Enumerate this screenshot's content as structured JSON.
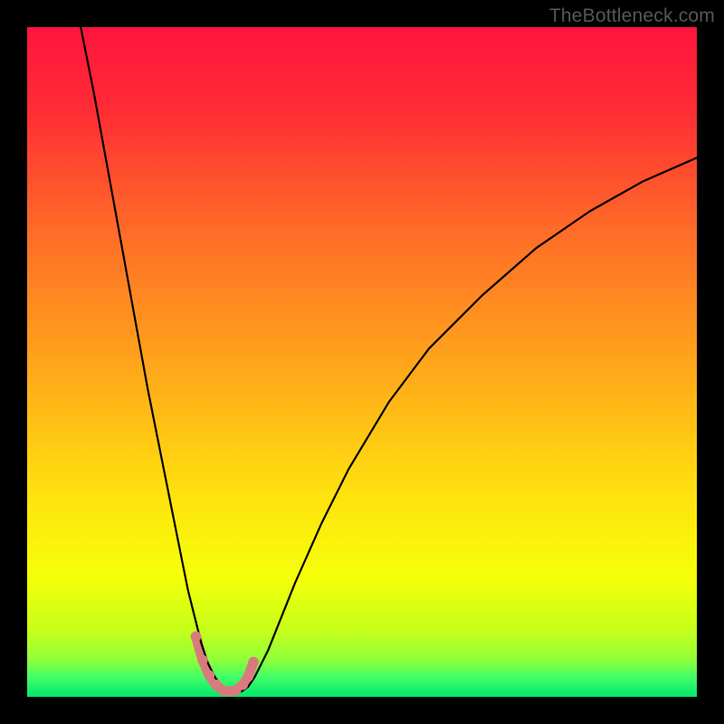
{
  "watermark": "TheBottleneck.com",
  "chart_data": {
    "type": "line",
    "title": "",
    "xlabel": "",
    "ylabel": "",
    "xlim": [
      0,
      100
    ],
    "ylim": [
      0,
      100
    ],
    "gradient_stops": [
      {
        "offset": 0.0,
        "color": "#ff153e"
      },
      {
        "offset": 0.12,
        "color": "#ff2b35"
      },
      {
        "offset": 0.3,
        "color": "#ff6a28"
      },
      {
        "offset": 0.5,
        "color": "#ffa41b"
      },
      {
        "offset": 0.7,
        "color": "#ffe20e"
      },
      {
        "offset": 0.82,
        "color": "#f6ff08"
      },
      {
        "offset": 0.9,
        "color": "#c7ff1a"
      },
      {
        "offset": 0.945,
        "color": "#8fff3a"
      },
      {
        "offset": 0.97,
        "color": "#44ff68"
      },
      {
        "offset": 1.0,
        "color": "#00e66b"
      }
    ],
    "series": [
      {
        "name": "curve",
        "stroke": "#000000",
        "stroke_width": 2.2,
        "x": [
          8,
          10,
          12,
          14,
          16,
          18,
          20,
          22,
          24,
          25,
          26,
          27,
          28,
          29,
          30,
          31,
          32,
          33,
          34,
          36,
          38,
          40,
          44,
          48,
          54,
          60,
          68,
          76,
          84,
          92,
          100
        ],
        "y": [
          100,
          90,
          79,
          68,
          57,
          46,
          36,
          26,
          16,
          12,
          8,
          5,
          3,
          1.5,
          0.8,
          0.6,
          0.8,
          1.5,
          3,
          7,
          12,
          17,
          26,
          34,
          44,
          52,
          60,
          67,
          72.5,
          77,
          80.5
        ]
      }
    ],
    "bottleneck_band": {
      "color": "#d97a7d",
      "stroke_width": 11,
      "x": [
        25.2,
        26.2,
        27.2,
        28.2,
        29.2,
        30.2,
        31.2,
        32.2,
        33.0,
        33.8
      ],
      "y": [
        9.0,
        5.5,
        3.2,
        1.8,
        1.0,
        0.8,
        1.0,
        1.8,
        3.0,
        5.2
      ]
    }
  }
}
